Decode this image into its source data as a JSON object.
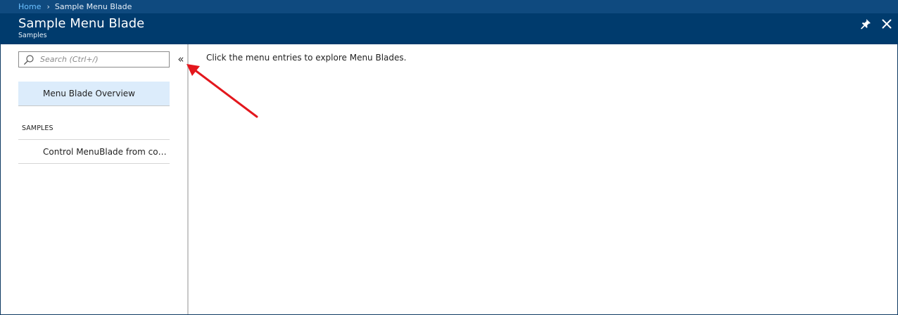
{
  "breadcrumb": {
    "home": "Home",
    "separator": "›",
    "current": "Sample Menu Blade"
  },
  "header": {
    "title": "Sample Menu Blade",
    "subtitle": "Samples"
  },
  "header_icons": {
    "pin": "pin-icon",
    "close": "close-icon"
  },
  "menu": {
    "search_placeholder": "Search (Ctrl+/)",
    "search_value": "",
    "collapse_glyph": "«",
    "overview_label": "Menu Blade Overview",
    "section_label": "SAMPLES",
    "items": [
      {
        "label": "Control MenuBlade from conten..."
      }
    ]
  },
  "content": {
    "text": "Click the menu entries to explore Menu Blades."
  },
  "colors": {
    "breadcrumb_bg": "#0f4a7f",
    "header_bg": "#003b6d",
    "selected_item_bg": "#dcecfb",
    "link": "#6cc0ff",
    "annotation_arrow": "#e3171d"
  }
}
